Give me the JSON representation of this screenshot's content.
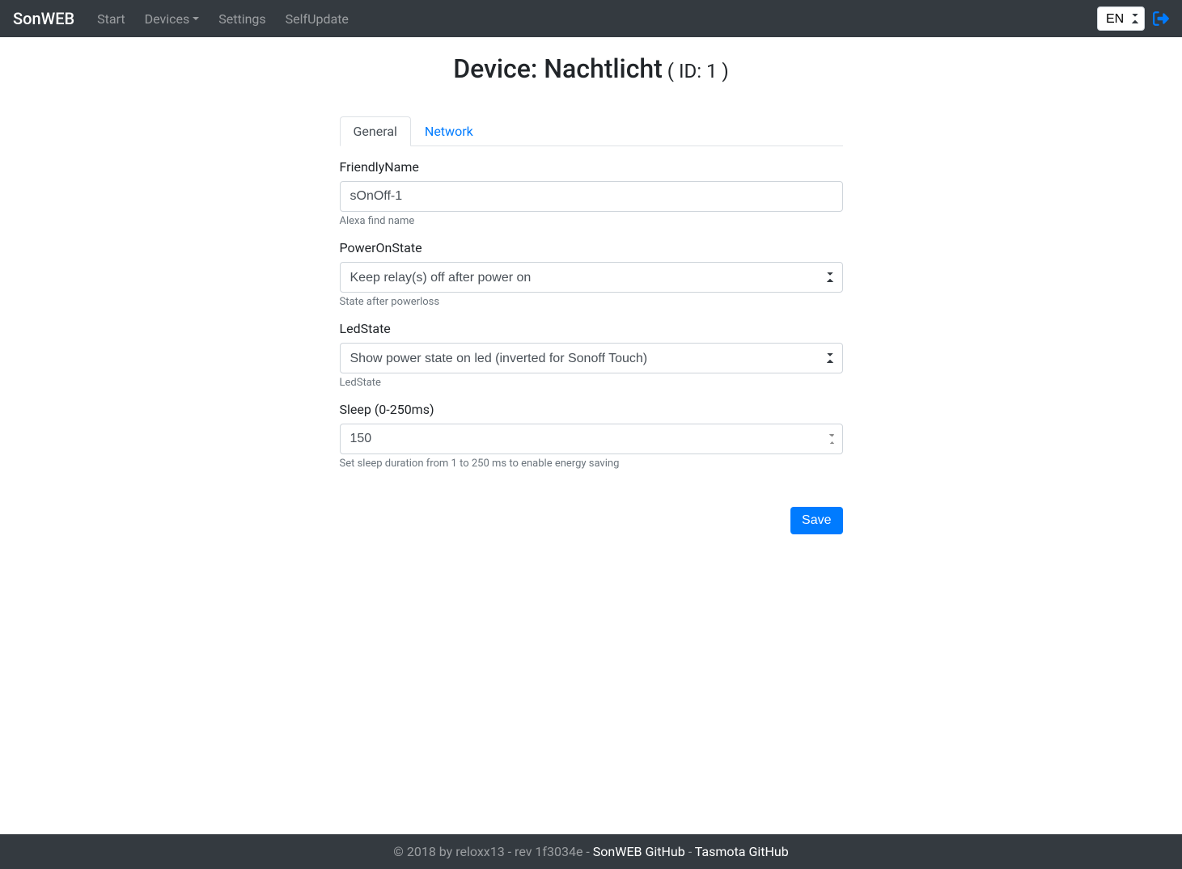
{
  "navbar": {
    "brand": "SonWEB",
    "links": {
      "start": "Start",
      "devices": "Devices",
      "settings": "Settings",
      "selfupdate": "SelfUpdate"
    },
    "lang": "EN"
  },
  "page": {
    "title_prefix": "Device: ",
    "device_name": "Nachtlicht",
    "id_label": " ( ID: 1 )"
  },
  "tabs": {
    "general": "General",
    "network": "Network"
  },
  "form": {
    "friendly_name": {
      "label": "FriendlyName",
      "value": "sOnOff-1",
      "help": "Alexa find name"
    },
    "power_on_state": {
      "label": "PowerOnState",
      "value": "Keep relay(s) off after power on",
      "help": "State after powerloss"
    },
    "led_state": {
      "label": "LedState",
      "value": "Show power state on led (inverted for Sonoff Touch)",
      "help": "LedState"
    },
    "sleep": {
      "label": "Sleep (0-250ms)",
      "value": "150",
      "help": "Set sleep duration from 1 to 250 ms to enable energy saving"
    },
    "save": "Save"
  },
  "footer": {
    "copyright": "© 2018 by reloxx13 - rev 1f3034e - ",
    "link1": "SonWEB GitHub",
    "sep": " - ",
    "link2": "Tasmota GitHub"
  }
}
